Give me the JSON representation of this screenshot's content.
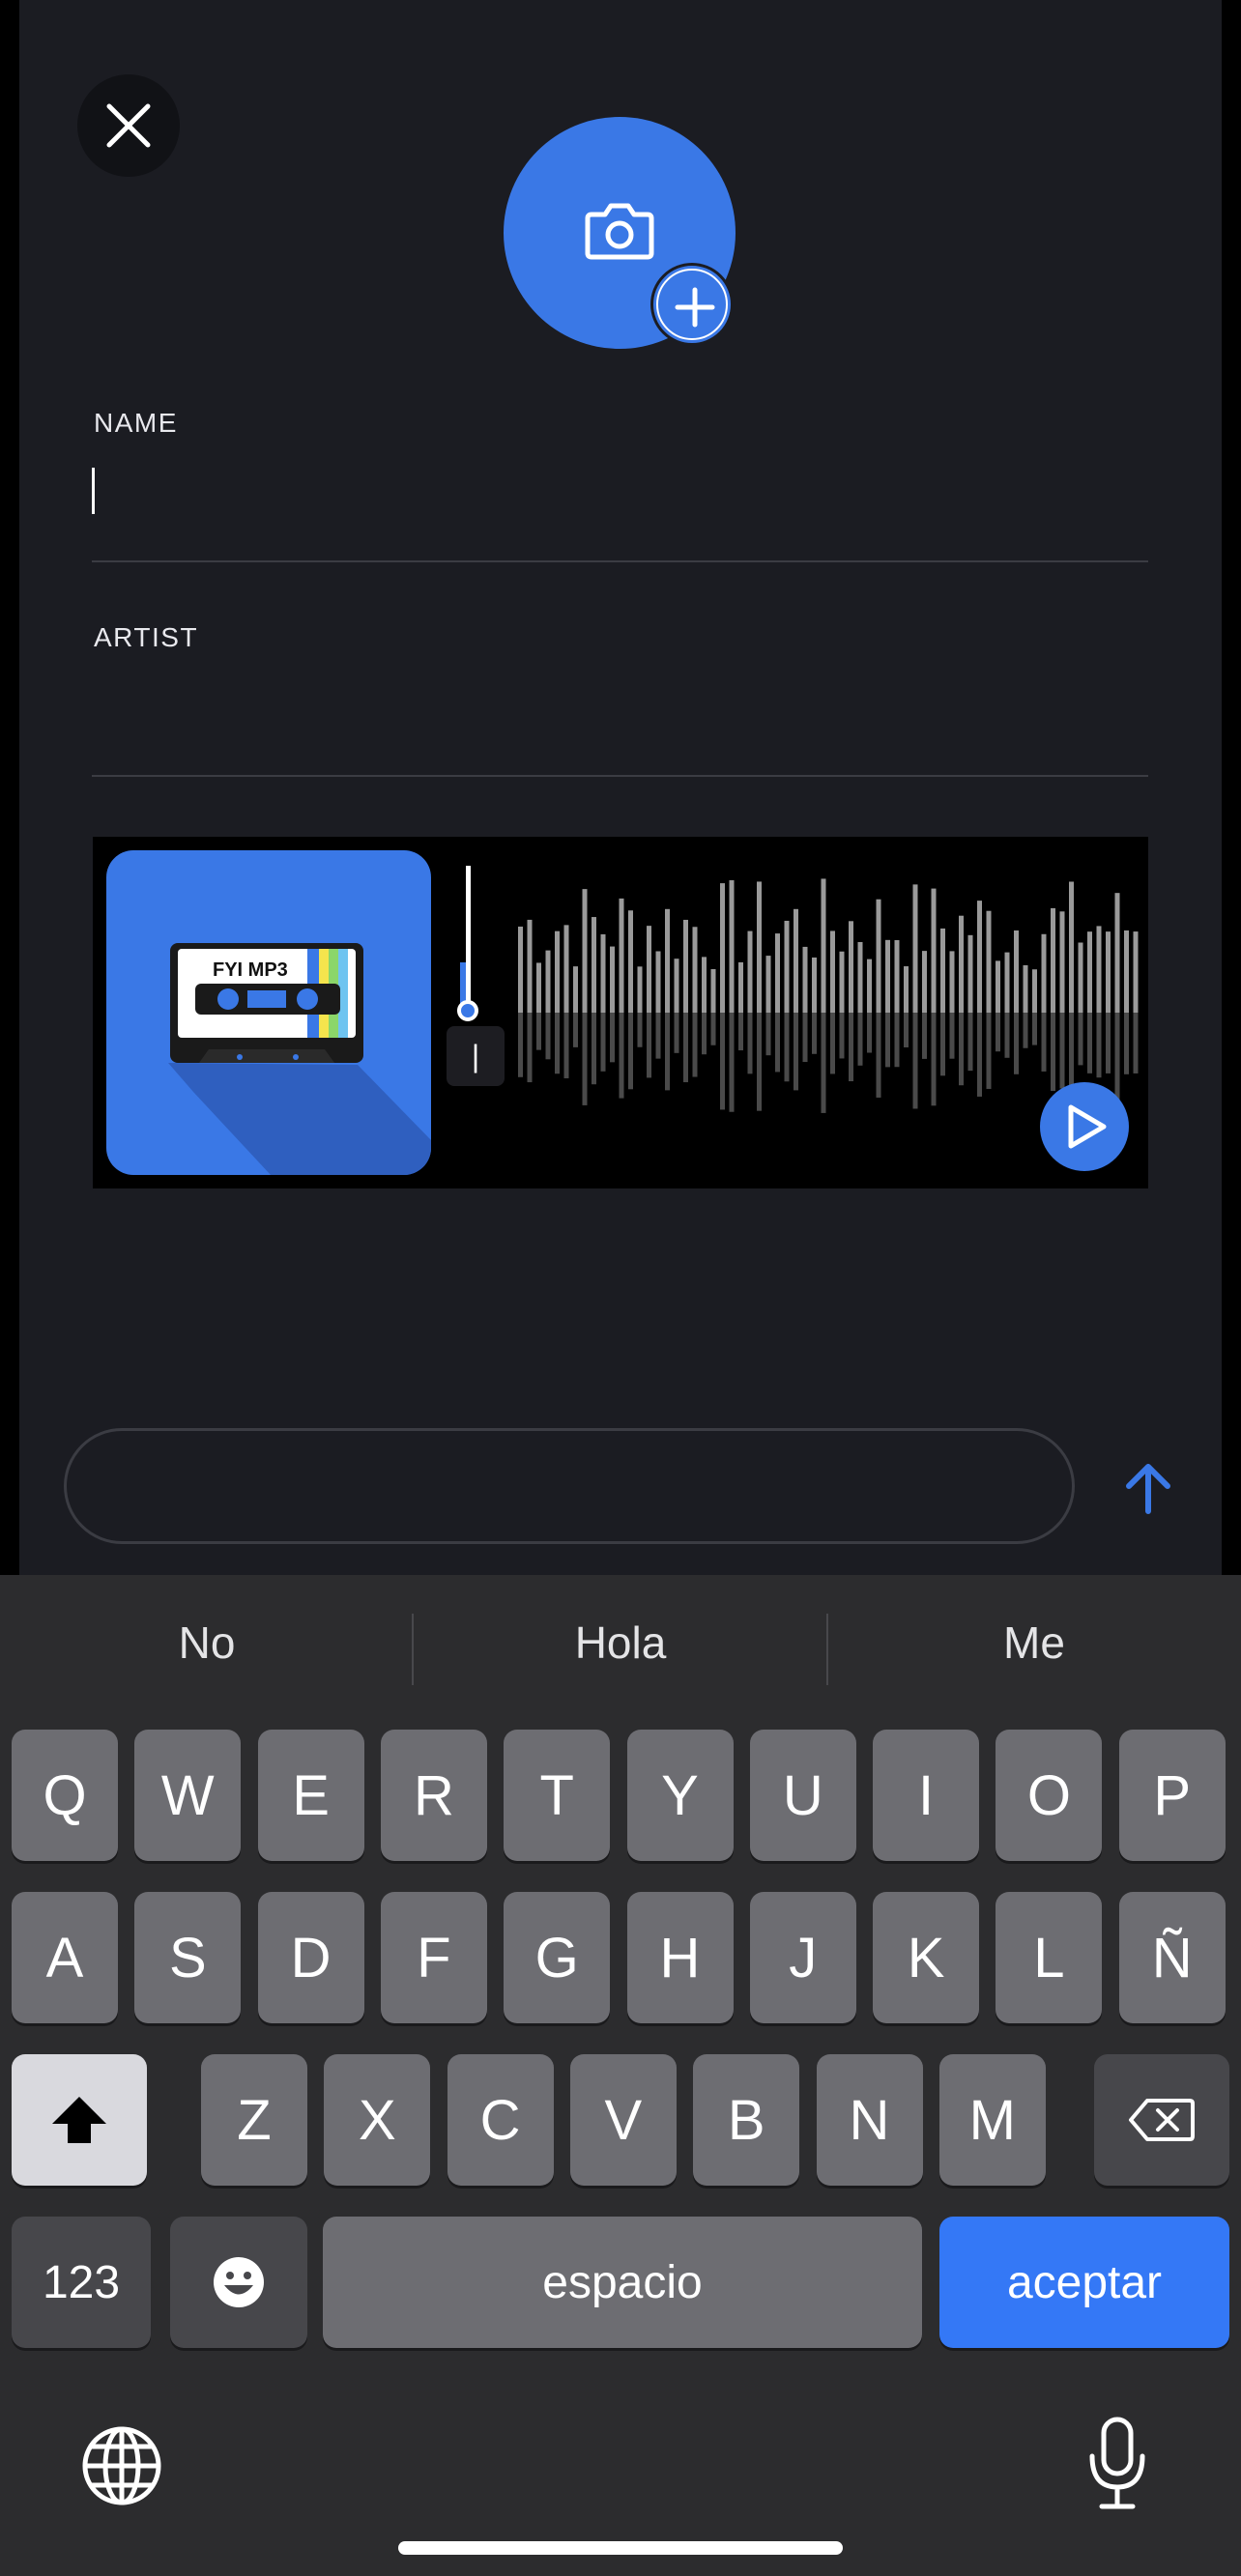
{
  "form": {
    "name_label": "NAME",
    "name_value": "",
    "artist_label": "ARTIST",
    "artist_value": ""
  },
  "media": {
    "cover_text": "FYI MP3",
    "trim_time": "|"
  },
  "composer": {
    "message_value": "",
    "message_placeholder": ""
  },
  "keyboard": {
    "suggestions": [
      "No",
      "Hola",
      "Me"
    ],
    "rows": [
      [
        "Q",
        "W",
        "E",
        "R",
        "T",
        "Y",
        "U",
        "I",
        "O",
        "P"
      ],
      [
        "A",
        "S",
        "D",
        "F",
        "G",
        "H",
        "J",
        "K",
        "L",
        "Ñ"
      ],
      [
        "Z",
        "X",
        "C",
        "V",
        "B",
        "N",
        "M"
      ]
    ],
    "numbers_label": "123",
    "space_label": "espacio",
    "return_label": "aceptar"
  },
  "colors": {
    "accent": "#3a78e6",
    "background": "#1b1c22",
    "keyboard": "#2c2c2e"
  },
  "icons": [
    "close-icon",
    "camera-icon",
    "plus-icon",
    "play-icon",
    "send-arrow-icon",
    "shift-icon",
    "backspace-icon",
    "emoji-icon",
    "globe-icon",
    "microphone-icon"
  ]
}
